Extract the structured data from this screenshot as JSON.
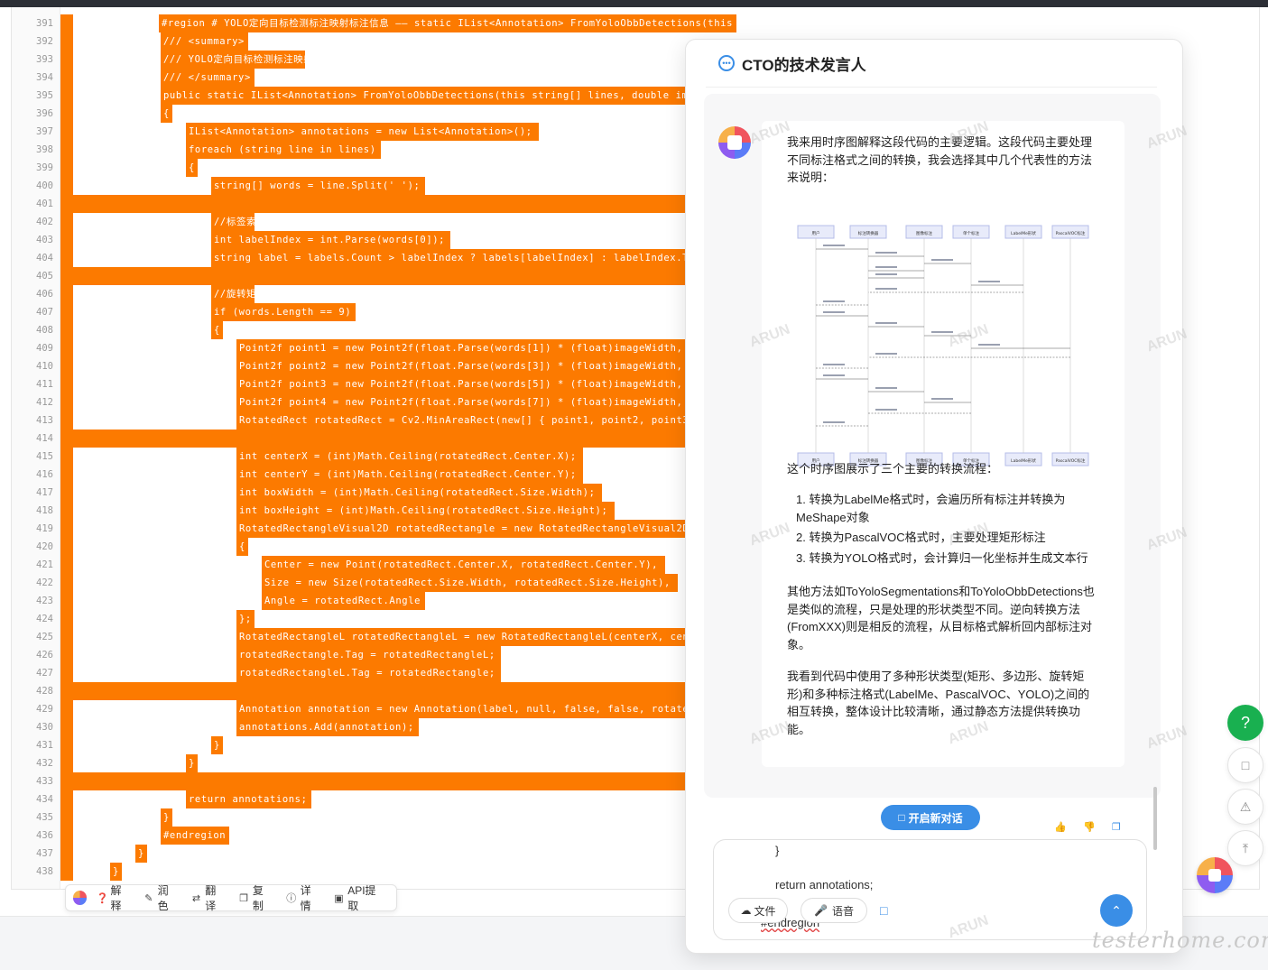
{
  "code": {
    "lines": [
      {
        "n": "391",
        "text": "#region # YOLO定向目标检测标注映射标注信息 —— static IList<Annotation> FromYoloObbDetections(this string[] lines..."
      },
      {
        "n": "392",
        "text": "/// <summary>"
      },
      {
        "n": "393",
        "text": "/// YOLO定向目标检测标注映射标注信息"
      },
      {
        "n": "394",
        "text": "/// </summary>"
      },
      {
        "n": "395",
        "text": "public static IList<Annotation> FromYoloObbDetections(this string[] lines, double imageW"
      },
      {
        "n": "396",
        "text": "{"
      },
      {
        "n": "397",
        "text": "IList<Annotation> annotations = new List<Annotation>();"
      },
      {
        "n": "398",
        "text": "foreach (string line in lines)"
      },
      {
        "n": "399",
        "text": "{"
      },
      {
        "n": "400",
        "text": "string[] words = line.Split(' ');"
      },
      {
        "n": "401",
        "text": ""
      },
      {
        "n": "402",
        "text": "//标签索引"
      },
      {
        "n": "403",
        "text": "int labelIndex = int.Parse(words[0]);"
      },
      {
        "n": "404",
        "text": "string label = labels.Count > labelIndex ? labels[labelIndex] : labelIndex.ToStr"
      },
      {
        "n": "405",
        "text": ""
      },
      {
        "n": "406",
        "text": "//旋转矩形"
      },
      {
        "n": "407",
        "text": "if (words.Length == 9)"
      },
      {
        "n": "408",
        "text": "{"
      },
      {
        "n": "409",
        "text": "Point2f point1 = new Point2f(float.Parse(words[1]) * (float)imageWidth, float"
      },
      {
        "n": "410",
        "text": "Point2f point2 = new Point2f(float.Parse(words[3]) * (float)imageWidth, float"
      },
      {
        "n": "411",
        "text": "Point2f point3 = new Point2f(float.Parse(words[5]) * (float)imageWidth, float"
      },
      {
        "n": "412",
        "text": "Point2f point4 = new Point2f(float.Parse(words[7]) * (float)imageWidth, float"
      },
      {
        "n": "413",
        "text": "RotatedRect rotatedRect = Cv2.MinAreaRect(new[] { point1, point2, point3, po"
      },
      {
        "n": "414",
        "text": ""
      },
      {
        "n": "415",
        "text": "int centerX = (int)Math.Ceiling(rotatedRect.Center.X);"
      },
      {
        "n": "416",
        "text": "int centerY = (int)Math.Ceiling(rotatedRect.Center.Y);"
      },
      {
        "n": "417",
        "text": "int boxWidth = (int)Math.Ceiling(rotatedRect.Size.Width);"
      },
      {
        "n": "418",
        "text": "int boxHeight = (int)Math.Ceiling(rotatedRect.Size.Height);"
      },
      {
        "n": "419",
        "text": "RotatedRectangleVisual2D rotatedRectangle = new RotatedRectangleVisual2D()"
      },
      {
        "n": "420",
        "text": "{"
      },
      {
        "n": "421",
        "text": "Center = new Point(rotatedRect.Center.X, rotatedRect.Center.Y),"
      },
      {
        "n": "422",
        "text": "Size = new Size(rotatedRect.Size.Width, rotatedRect.Size.Height),"
      },
      {
        "n": "423",
        "text": "Angle = rotatedRect.Angle"
      },
      {
        "n": "424",
        "text": "};"
      },
      {
        "n": "425",
        "text": "RotatedRectangleL rotatedRectangleL = new RotatedRectangleL(centerX, centerY"
      },
      {
        "n": "426",
        "text": "rotatedRectangle.Tag = rotatedRectangleL;"
      },
      {
        "n": "427",
        "text": "rotatedRectangleL.Tag = rotatedRectangle;"
      },
      {
        "n": "428",
        "text": ""
      },
      {
        "n": "429",
        "text": "Annotation annotation = new Annotation(label, null, false, false, rotatedRec"
      },
      {
        "n": "430",
        "text": "annotations.Add(annotation);"
      },
      {
        "n": "431",
        "text": "}"
      },
      {
        "n": "432",
        "text": "}"
      },
      {
        "n": "433",
        "text": ""
      },
      {
        "n": "434",
        "text": "return annotations;"
      },
      {
        "n": "435",
        "text": "}"
      },
      {
        "n": "436",
        "text": "#endregion"
      },
      {
        "n": "437",
        "text": "}"
      },
      {
        "n": "438",
        "text": "}"
      }
    ]
  },
  "toolbar": {
    "items": [
      "解释",
      "润色",
      "翻译",
      "复制",
      "详情",
      "API提取"
    ]
  },
  "chat": {
    "title": "CTO的技术发言人",
    "intro": "我来用时序图解释这段代码的主要逻辑。这段代码主要处理不同标注格式之间的转换，我会选择其中几个代表性的方法来说明：",
    "diagram_lead": "这个时序图展示了三个主要的转换流程：",
    "list": [
      "转换为LabelMe格式时，会遍历所有标注并转换为MeShape对象",
      "转换为PascalVOC格式时，主要处理矩形标注",
      "转换为YOLO格式时，会计算归一化坐标并生成文本行"
    ],
    "para2": "其他方法如ToYoloSegmentations和ToYoloObbDetections也是类似的流程，只是处理的形状类型不同。逆向转换方法(FromXXX)则是相反的流程，从目标格式解析回内部标注对象。",
    "para3": "我看到代码中使用了多种形状类型(矩形、多边形、旋转矩形)和多种标注格式(LabelMe、PascalVOC、YOLO)之间的相互转换，整体设计比较清晰，通过静态方法提供转换功能。",
    "new_chat_label": "开启新对话",
    "input_lines": [
      "}",
      "return annotations;",
      "#endregion"
    ],
    "file_label": "文件",
    "voice_label": "语音",
    "watermark": "ARUN"
  },
  "diagram": {
    "participants": [
      "用户",
      "标注转换器",
      "图像标注",
      "单个标注",
      "LabelMe形状",
      "PascalVOC标注"
    ]
  },
  "site_watermark": "testerhome.com",
  "side": {
    "help": "?"
  },
  "colors": {
    "highlight": "#fc7a00",
    "accent": "#3a8ee6",
    "help": "#19b050"
  }
}
